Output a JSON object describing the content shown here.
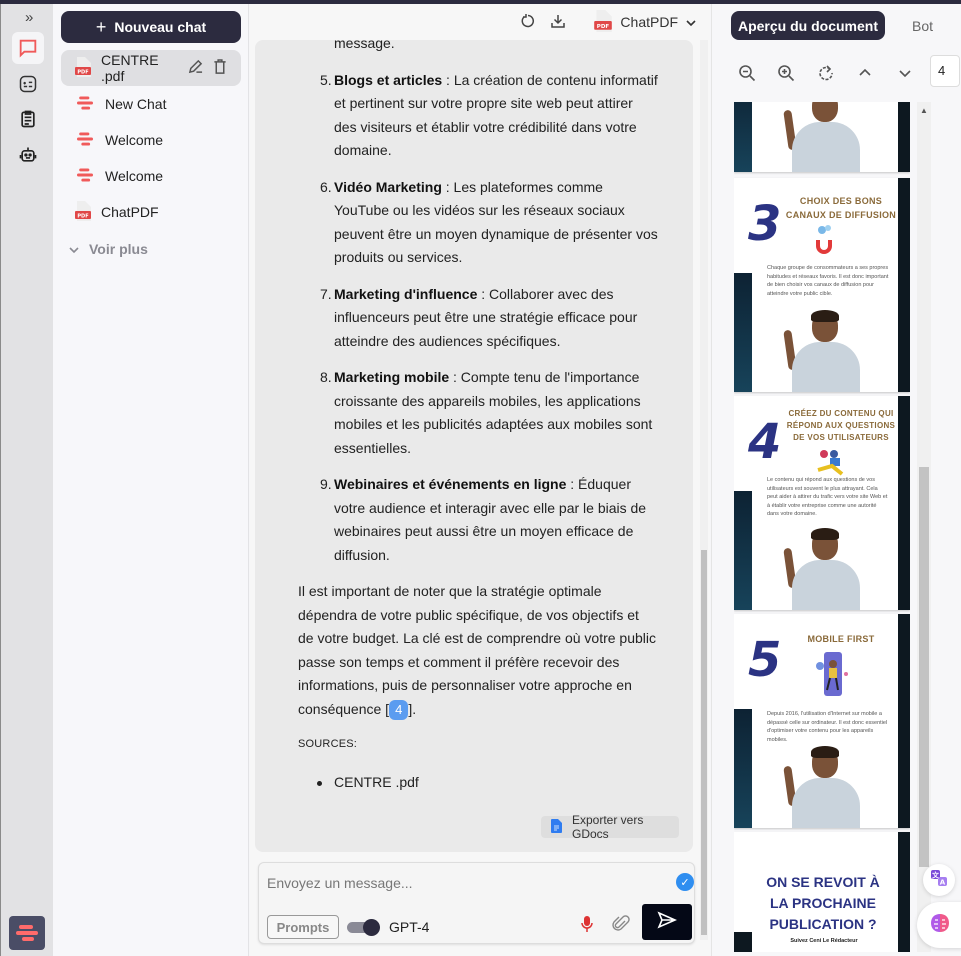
{
  "rail": {
    "expand_icon": "»",
    "items": [
      {
        "name": "chat",
        "active": true
      },
      {
        "name": "tools",
        "active": false
      },
      {
        "name": "clipboard",
        "active": false
      },
      {
        "name": "bot",
        "active": false
      }
    ]
  },
  "sidebar": {
    "new_chat_label": "Nouveau chat",
    "chats": [
      {
        "label": "CENTRE .pdf",
        "icon": "pdf",
        "active": true
      },
      {
        "label": "New Chat",
        "icon": "chat-logo",
        "active": false
      },
      {
        "label": "Welcome",
        "icon": "chat-logo",
        "active": false
      },
      {
        "label": "Welcome",
        "icon": "chat-logo",
        "active": false
      },
      {
        "label": "ChatPDF",
        "icon": "pdf",
        "active": false
      }
    ],
    "see_more_label": "Voir plus"
  },
  "header": {
    "model_name": "ChatPDF"
  },
  "message": {
    "top_fragment": "message.",
    "items": [
      {
        "num": "5.",
        "title": "Blogs et articles",
        "text": " : La création de contenu informatif et pertinent sur votre propre site web peut attirer des visiteurs et établir votre crédibilité dans votre domaine."
      },
      {
        "num": "6.",
        "title": "Vidéo Marketing",
        "text": " : Les plateformes comme YouTube ou les vidéos sur les réseaux sociaux peuvent être un moyen dynamique de présenter vos produits ou services."
      },
      {
        "num": "7.",
        "title": "Marketing d'influence",
        "text": " : Collaborer avec des influenceurs peut être une stratégie efficace pour atteindre des audiences spécifiques."
      },
      {
        "num": "8.",
        "title": "Marketing mobile",
        "text": " : Compte tenu de l'importance croissante des appareils mobiles, les applications mobiles et les publicités adaptées aux mobiles sont essentielles."
      },
      {
        "num": "9.",
        "title": "Webinaires et événements en ligne",
        "text": " : Éduquer votre audience et interagir avec elle par le biais de webinaires peut aussi être un moyen efficace de diffusion."
      }
    ],
    "conclusion": "Il est important de noter que la stratégie optimale dépendra de votre public spécifique, de vos objectifs et de votre budget. La clé est de comprendre où votre public passe son temps et comment il préfère recevoir des informations, puis de personnaliser votre approche en conséquence [",
    "citation": "4",
    "conclusion_end": "].",
    "sources_label": "SOURCES:",
    "sources": [
      "CENTRE .pdf"
    ],
    "export_label": "Exporter vers GDocs"
  },
  "composer": {
    "placeholder": "Envoyez un message...",
    "prompts_label": "Prompts",
    "model_toggle_on": true,
    "model_label": "GPT-4"
  },
  "right_panel": {
    "tab_active": "Aperçu du document",
    "tab_other": "Bot",
    "page_number": "4",
    "pages": [
      {
        "num": "",
        "title": "",
        "body": ""
      },
      {
        "num": "3",
        "title": "CHOIX DES BONS CANAUX DE DIFFUSION",
        "body": "Chaque groupe de consommateurs a ses propres habitudes et réseaux favoris. Il est donc important de bien choisir vos canaux de diffusion pour atteindre votre public cible."
      },
      {
        "num": "4",
        "title": "CRÉEZ DU CONTENU QUI RÉPOND AUX QUESTIONS DE VOS UTILISATEURS",
        "body": "Le contenu qui répond aux questions de vos utilisateurs est souvent le plus attrayant. Cela peut aider à attirer du trafic vers votre site Web et à établir votre entreprise comme une autorité dans votre domaine."
      },
      {
        "num": "5",
        "title": "MOBILE FIRST",
        "body": "Depuis 2016, l'utilisation d'Internet sur mobile a dépassé celle sur ordinateur. Il est donc essentiel d'optimiser votre contenu pour les appareils mobiles."
      },
      {
        "num": "",
        "title": "ON SE REVOIT À LA PROCHAINE PUBLICATION ?",
        "body": "Suivez Ceni Le Rédacteur"
      }
    ]
  },
  "colors": {
    "primary": "#2c2b3f",
    "accent_red": "#f05a5a",
    "citation_blue": "#5b9cf0",
    "send_button": "#040816"
  }
}
